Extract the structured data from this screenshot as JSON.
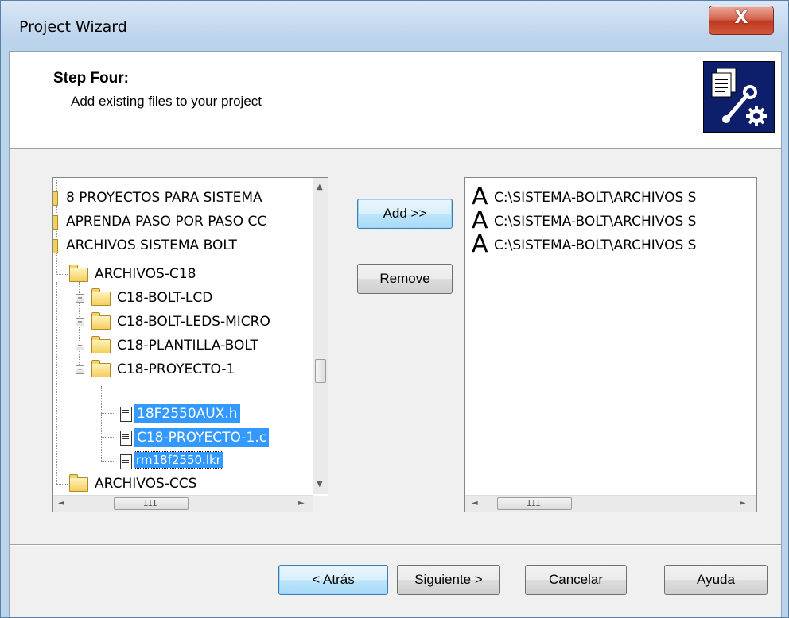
{
  "window": {
    "title": "Project Wizard",
    "close_glyph": "X"
  },
  "header": {
    "step_title": "Step Four:",
    "step_subtitle": "Add existing files to your project",
    "icon": "project-settings-icon"
  },
  "tree": {
    "items": [
      {
        "label": "8 PROYECTOS PARA SISTEMA",
        "kind": "folder",
        "selected": false
      },
      {
        "label": "APRENDA PASO POR PASO CC",
        "kind": "folder",
        "selected": false
      },
      {
        "label": "ARCHIVOS SISTEMA BOLT",
        "kind": "folder",
        "selected": false
      },
      {
        "label": "ARCHIVOS-C18",
        "kind": "folder",
        "selected": false
      },
      {
        "label": "C18-BOLT-LCD",
        "kind": "folder",
        "selected": false
      },
      {
        "label": "C18-BOLT-LEDS-MICRO",
        "kind": "folder",
        "selected": false
      },
      {
        "label": "C18-PLANTILLA-BOLT",
        "kind": "folder",
        "selected": false
      },
      {
        "label": "C18-PROYECTO-1",
        "kind": "folder",
        "selected": false
      },
      {
        "label": "18F2550AUX.h",
        "kind": "file",
        "selected": true
      },
      {
        "label": "C18-PROYECTO-1.c",
        "kind": "file",
        "selected": true
      },
      {
        "label": "rm18f2550.lkr",
        "kind": "file",
        "selected": true
      },
      {
        "label": "ARCHIVOS-CCS",
        "kind": "folder",
        "selected": false
      }
    ]
  },
  "buttons": {
    "add": "Add >>",
    "remove": "Remove",
    "back_prefix": "< ",
    "back_mnemonic": "A",
    "back_rest": "trás",
    "next_prefix": "Siguien",
    "next_mnemonic": "t",
    "next_rest": "e >",
    "cancel": "Cancelar",
    "help": "Ayuda"
  },
  "files": {
    "items": [
      {
        "glyph": "A",
        "path": "C:\\SISTEMA-BOLT\\ARCHIVOS S"
      },
      {
        "glyph": "A",
        "path": "C:\\SISTEMA-BOLT\\ARCHIVOS S"
      },
      {
        "glyph": "A",
        "path": "C:\\SISTEMA-BOLT\\ARCHIVOS S"
      }
    ]
  },
  "scroll": {
    "up_glyph": "▲",
    "down_glyph": "▼",
    "left_glyph": "◄",
    "right_glyph": "►",
    "grip_glyph": "III"
  }
}
